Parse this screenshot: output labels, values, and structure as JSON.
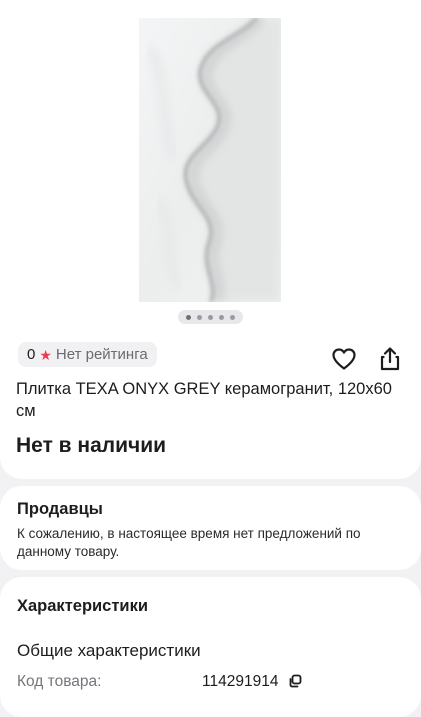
{
  "rating": {
    "score": "0",
    "label": "Нет рейтинга"
  },
  "gallery": {
    "total_images": 5,
    "active_index": 0
  },
  "product": {
    "title": "Плитка TEXA ONYX GREY керамогранит, 120х60 см",
    "availability": "Нет в наличии"
  },
  "sellers": {
    "title": "Продавцы",
    "message": "К сожалению, в настоящее время нет предложений по данному товару."
  },
  "specs": {
    "title": "Характеристики",
    "subtitle": "Общие характеристики",
    "rows": [
      {
        "key": "Код товара:",
        "value": "114291914"
      }
    ]
  },
  "icons": {
    "favorite": "heart-icon",
    "share": "share-icon",
    "star": "star-icon",
    "copy": "copy-icon"
  },
  "colors": {
    "star": "#f03a4f",
    "page_background": "#f2f2f4",
    "card_background": "#ffffff"
  }
}
